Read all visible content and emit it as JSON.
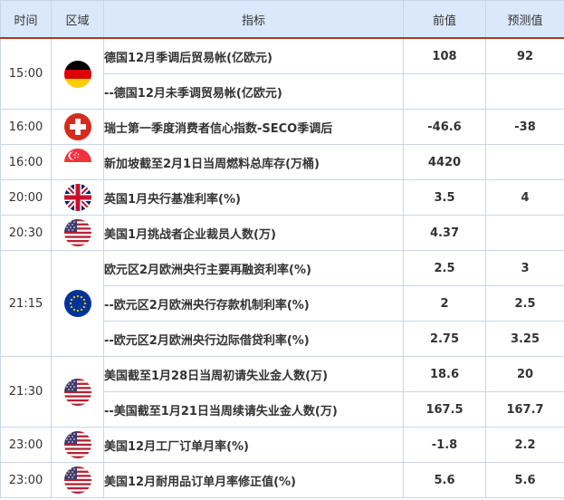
{
  "header": {
    "time": "时间",
    "region": "区域",
    "indicator": "指标",
    "previous": "前值",
    "forecast": "预测值"
  },
  "rows": [
    {
      "time": "15:00",
      "flag_icon": "germany-flag-icon",
      "items": [
        {
          "indicator": "德国12月季调后贸易帐(亿欧元)",
          "previous": "108",
          "forecast": "92"
        },
        {
          "indicator": "--德国12月未季调贸易帐(亿欧元)",
          "previous": "",
          "forecast": ""
        }
      ]
    },
    {
      "time": "16:00",
      "flag_icon": "switzerland-flag-icon",
      "items": [
        {
          "indicator": "瑞士第一季度消费者信心指数-SECO季调后",
          "previous": "-46.6",
          "forecast": "-38"
        }
      ]
    },
    {
      "time": "16:00",
      "flag_icon": "singapore-flag-icon",
      "items": [
        {
          "indicator": "新加坡截至2月1日当周燃料总库存(万桶)",
          "previous": "4420",
          "forecast": ""
        }
      ]
    },
    {
      "time": "20:00",
      "flag_icon": "uk-flag-icon",
      "items": [
        {
          "indicator": "英国1月央行基准利率(%)",
          "previous": "3.5",
          "forecast": "4"
        }
      ]
    },
    {
      "time": "20:30",
      "flag_icon": "us-flag-icon",
      "items": [
        {
          "indicator": "美国1月挑战者企业裁员人数(万)",
          "previous": "4.37",
          "forecast": ""
        }
      ]
    },
    {
      "time": "21:15",
      "flag_icon": "eu-flag-icon",
      "items": [
        {
          "indicator": "欧元区2月欧洲央行主要再融资利率(%)",
          "previous": "2.5",
          "forecast": "3"
        },
        {
          "indicator": "--欧元区2月欧洲央行存款机制利率(%)",
          "previous": "2",
          "forecast": "2.5"
        },
        {
          "indicator": "--欧元区2月欧洲央行边际借贷利率(%)",
          "previous": "2.75",
          "forecast": "3.25"
        }
      ]
    },
    {
      "time": "21:30",
      "flag_icon": "us-flag-icon",
      "items": [
        {
          "indicator": "美国截至1月28日当周初请失业金人数(万)",
          "previous": "18.6",
          "forecast": "20"
        },
        {
          "indicator": "--美国截至1月21日当周续请失业金人数(万)",
          "previous": "167.5",
          "forecast": "167.7"
        }
      ]
    },
    {
      "time": "23:00",
      "flag_icon": "us-flag-icon",
      "items": [
        {
          "indicator": "美国12月工厂订单月率(%)",
          "previous": "-1.8",
          "forecast": "2.2"
        }
      ]
    },
    {
      "time": "23:00",
      "flag_icon": "us-flag-icon",
      "items": [
        {
          "indicator": "美国12月耐用品订单月率修正值(%)",
          "previous": "5.6",
          "forecast": "5.6"
        }
      ]
    }
  ],
  "colors": {
    "accent": "#b8251c",
    "header_bg": "#dbe8fb",
    "border": "#c9d6ea"
  }
}
